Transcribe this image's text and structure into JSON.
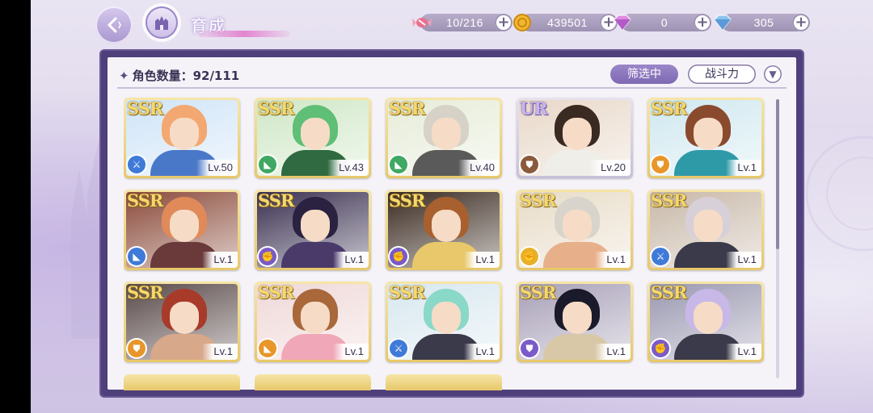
{
  "header": {
    "title": "育成",
    "resources": [
      {
        "icon": "candy-icon",
        "value": "10/216",
        "color": "#e06a8a"
      },
      {
        "icon": "gold-coin-icon",
        "value": "439501",
        "color": "#f2b630"
      },
      {
        "icon": "pink-diamond-icon",
        "value": "0",
        "color": "#d77ad6"
      },
      {
        "icon": "blue-diamond-icon",
        "value": "305",
        "color": "#6fa8e8"
      }
    ]
  },
  "panel": {
    "count_label": "角色数量：92/111",
    "filter_label": "筛选中",
    "sort_label": "战斗力"
  },
  "colors": {
    "panel_border": "#4f3f7a",
    "filter_active": "#8a75be",
    "ssr_frame": "#e7c86a"
  },
  "cards": [
    {
      "rarity": "SSR",
      "level": "Lv.50",
      "element": "dagger-icon",
      "element_color": "#3f7ad8",
      "hair": "#f2a870",
      "outfit": "#4a78c8",
      "bg": "#cfe4f8"
    },
    {
      "rarity": "SSR",
      "level": "Lv.43",
      "element": "boot-icon",
      "element_color": "#3fa862",
      "hair": "#5fbf76",
      "outfit": "#2f6a40",
      "bg": "#cfe7c6"
    },
    {
      "rarity": "SSR",
      "level": "Lv.40",
      "element": "boot-icon",
      "element_color": "#3fa862",
      "hair": "#d7d2c8",
      "outfit": "#5a5a5a",
      "bg": "#e6ecd8"
    },
    {
      "rarity": "UR",
      "level": "Lv.20",
      "element": "shield-icon",
      "element_color": "#8a5a3a",
      "hair": "#3a2a22",
      "outfit": "#f0eee8",
      "bg": "#e8d8c8"
    },
    {
      "rarity": "SSR",
      "level": "Lv.1",
      "element": "shield-icon",
      "element_color": "#e8962a",
      "hair": "#8a4a2e",
      "outfit": "#2e9aa8",
      "bg": "#cfe8f0"
    },
    {
      "rarity": "SSR",
      "level": "Lv.1",
      "element": "boot-icon",
      "element_color": "#3f7ad8",
      "hair": "#e08a5a",
      "outfit": "#6a3a3a",
      "bg": "#8a4a3a"
    },
    {
      "rarity": "SSR",
      "level": "Lv.1",
      "element": "fist-icon",
      "element_color": "#7a5ac8",
      "hair": "#2a2240",
      "outfit": "#4a3a6a",
      "bg": "#3a3050"
    },
    {
      "rarity": "SSR",
      "level": "Lv.1",
      "element": "fist-icon",
      "element_color": "#7a5ac8",
      "hair": "#a8602e",
      "outfit": "#e8c86a",
      "bg": "#3a2a20"
    },
    {
      "rarity": "SSR",
      "level": "Lv.1",
      "element": "fist-icon",
      "element_color": "#e8b02a",
      "hair": "#d8d4cc",
      "outfit": "#e8b08a",
      "bg": "#e8dcc8"
    },
    {
      "rarity": "SSR",
      "level": "Lv.1",
      "element": "dagger-icon",
      "element_color": "#3f7ad8",
      "hair": "#d8d0d8",
      "outfit": "#3a3a4a",
      "bg": "#c8b8a8"
    },
    {
      "rarity": "SSR",
      "level": "Lv.1",
      "element": "shield-icon",
      "element_color": "#e8962a",
      "hair": "#a83a2a",
      "outfit": "#d8a88a",
      "bg": "#5a4a4a"
    },
    {
      "rarity": "SSR",
      "level": "Lv.1",
      "element": "boot-icon",
      "element_color": "#e8962a",
      "hair": "#a8683a",
      "outfit": "#f0a8b8",
      "bg": "#f0d8d8"
    },
    {
      "rarity": "SSR",
      "level": "Lv.1",
      "element": "dagger-icon",
      "element_color": "#3f7ad8",
      "hair": "#8ad8c8",
      "outfit": "#3a3a4a",
      "bg": "#d8e8f0"
    },
    {
      "rarity": "SSR",
      "level": "Lv.1",
      "element": "shield-icon",
      "element_color": "#7a5ac8",
      "hair": "#1a1a2a",
      "outfit": "#d8c8a8",
      "bg": "#a8a0b8"
    },
    {
      "rarity": "SSR",
      "level": "Lv.1",
      "element": "fist-icon",
      "element_color": "#7a5ac8",
      "hair": "#c8b8e8",
      "outfit": "#3a3a4a",
      "bg": "#9a98b0"
    }
  ]
}
